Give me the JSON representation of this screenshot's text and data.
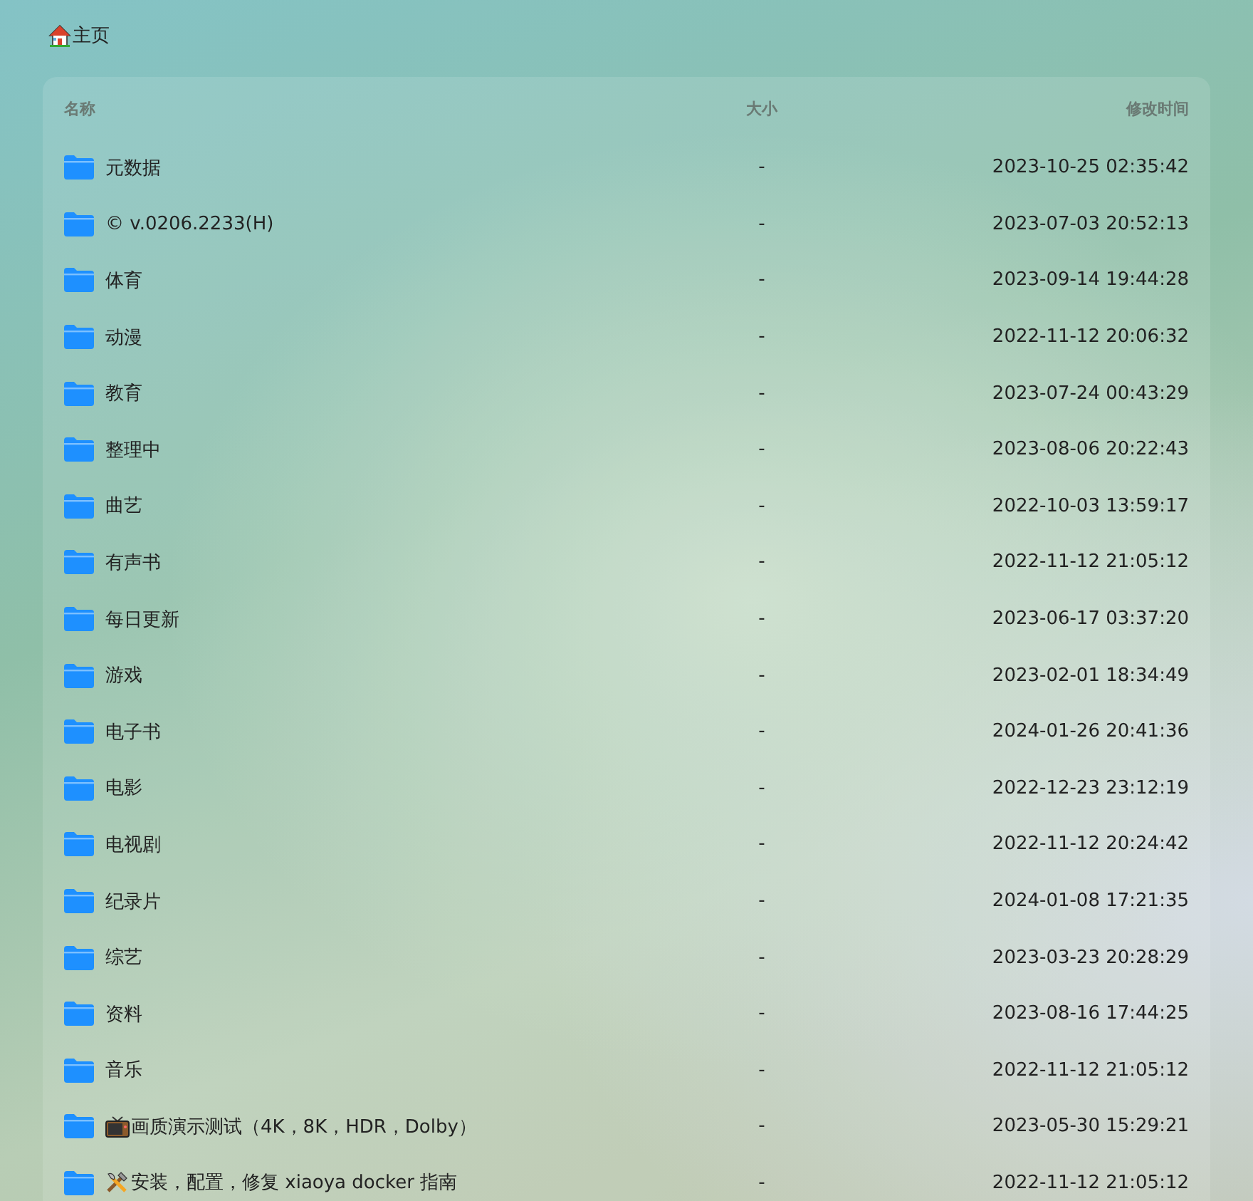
{
  "breadcrumb": {
    "label": "主页"
  },
  "table": {
    "columns": [
      "名称",
      "大小",
      "修改时间"
    ],
    "rows": [
      {
        "name": "元数据",
        "size": "-",
        "modified": "2023-10-25 02:35:42"
      },
      {
        "name": "© v.0206.2233(H)",
        "size": "-",
        "modified": "2023-07-03 20:52:13"
      },
      {
        "name": "体育",
        "size": "-",
        "modified": "2023-09-14 19:44:28"
      },
      {
        "name": "动漫",
        "size": "-",
        "modified": "2022-11-12 20:06:32"
      },
      {
        "name": "教育",
        "size": "-",
        "modified": "2023-07-24 00:43:29"
      },
      {
        "name": "整理中",
        "size": "-",
        "modified": "2023-08-06 20:22:43"
      },
      {
        "name": "曲艺",
        "size": "-",
        "modified": "2022-10-03 13:59:17"
      },
      {
        "name": "有声书",
        "size": "-",
        "modified": "2022-11-12 21:05:12"
      },
      {
        "name": "每日更新",
        "size": "-",
        "modified": "2023-06-17 03:37:20"
      },
      {
        "name": "游戏",
        "size": "-",
        "modified": "2023-02-01 18:34:49"
      },
      {
        "name": "电子书",
        "size": "-",
        "modified": "2024-01-26 20:41:36"
      },
      {
        "name": "电影",
        "size": "-",
        "modified": "2022-12-23 23:12:19"
      },
      {
        "name": "电视剧",
        "size": "-",
        "modified": "2022-11-12 20:24:42"
      },
      {
        "name": "纪录片",
        "size": "-",
        "modified": "2024-01-08 17:21:35"
      },
      {
        "name": "综艺",
        "size": "-",
        "modified": "2023-03-23 20:28:29"
      },
      {
        "name": "资料",
        "size": "-",
        "modified": "2023-08-16 17:44:25"
      },
      {
        "name": "音乐",
        "size": "-",
        "modified": "2022-11-12 21:05:12"
      },
      {
        "name": "画质演示测试（4K，8K，HDR，Dolby）",
        "size": "-",
        "modified": "2023-05-30 15:29:21",
        "kind": "tv"
      },
      {
        "name": "安装，配置，修复 xiaoya docker 指南",
        "size": "-",
        "modified": "2022-11-12 21:05:12",
        "kind": "tools"
      }
    ]
  }
}
